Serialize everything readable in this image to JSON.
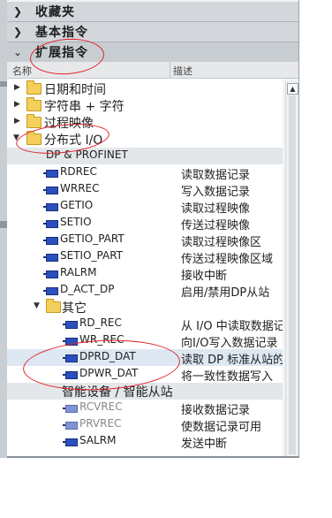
{
  "panels": {
    "favorites": "收藏夹",
    "basic_instructions": "基本指令",
    "extended_instructions": "扩展指令"
  },
  "columns": {
    "name": "名称",
    "description": "描述"
  },
  "tree": {
    "datetime": "日期和时间",
    "string_char": "字符串 + 字符",
    "process_image": "过程映像",
    "distributed_io": "分布式 I/O",
    "dp_profinet": "DP & PROFINET",
    "others": "其它",
    "smart_device": "智能设备 / 智能从站"
  },
  "rows": [
    {
      "name": "RDREC",
      "desc": "读取数据记录"
    },
    {
      "name": "WRREC",
      "desc": "写入数据记录"
    },
    {
      "name": "GETIO",
      "desc": "读取过程映像"
    },
    {
      "name": "SETIO",
      "desc": "传送过程映像"
    },
    {
      "name": "GETIO_PART",
      "desc": "读取过程映像区"
    },
    {
      "name": "SETIO_PART",
      "desc": "传送过程映像区域"
    },
    {
      "name": "RALRM",
      "desc": "接收中断"
    },
    {
      "name": "D_ACT_DP",
      "desc": "启用/禁用DP从站"
    }
  ],
  "other_rows": [
    {
      "name": "RD_REC",
      "desc": "从 I/O 中读取数据记录"
    },
    {
      "name": "WR_REC",
      "desc": "向I/O写入数据记录"
    },
    {
      "name": "DPRD_DAT",
      "desc": "读取 DP 标准从站的一致性数据"
    },
    {
      "name": "DPWR_DAT",
      "desc": "将一致性数据写入"
    }
  ],
  "smart_rows": [
    {
      "name": "RCVREC",
      "desc": "接收数据记录"
    },
    {
      "name": "PRVREC",
      "desc": "使数据记录可用"
    },
    {
      "name": "SALRM",
      "desc": "发送中断"
    }
  ],
  "colors": {
    "annotation": "#e2202a",
    "header_bg": "#d3d7db",
    "block_icon": "#2b4fbf",
    "folder": "#f4cf5c"
  }
}
